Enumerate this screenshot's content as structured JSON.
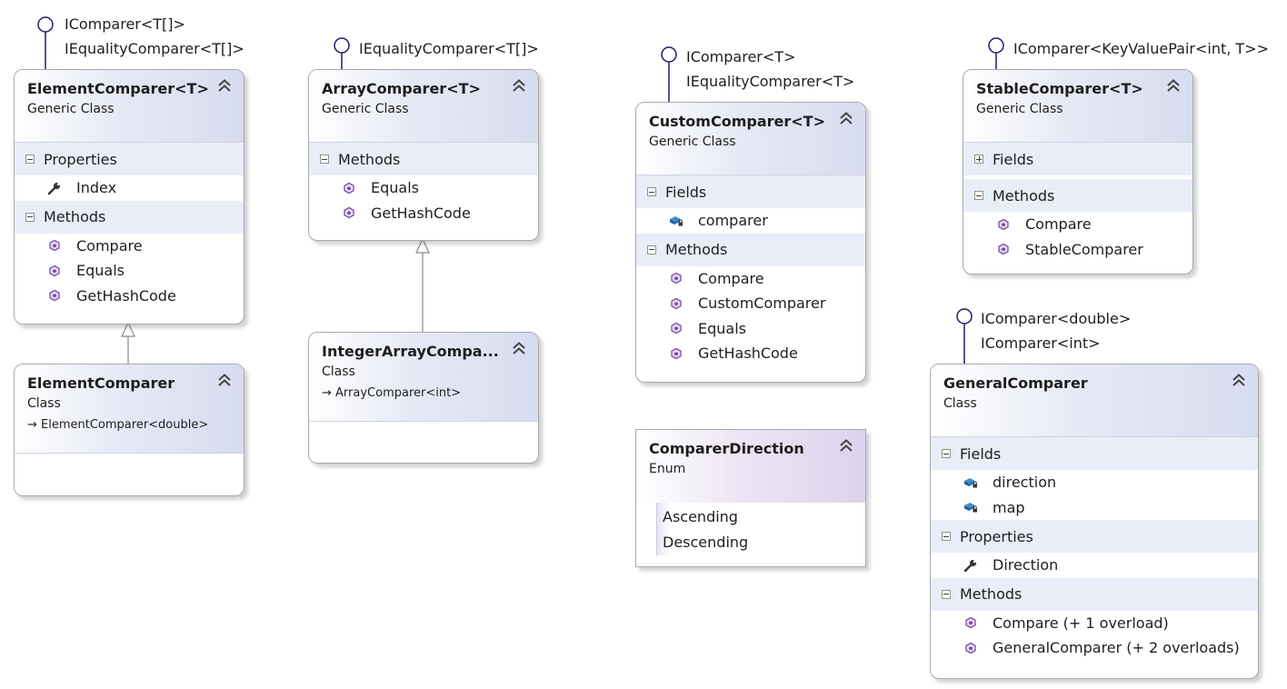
{
  "elements": {
    "element_comparer_generic": {
      "name": "ElementComparer<T>",
      "kind": "Generic Class",
      "interfaces": [
        "IComparer<T[]>",
        "IEqualityComparer<T[]>"
      ],
      "sections": [
        {
          "title": "Properties",
          "members": [
            {
              "name": "Index",
              "icon": "wrench-icon"
            }
          ]
        },
        {
          "title": "Methods",
          "members": [
            {
              "name": "Compare",
              "icon": "method-icon"
            },
            {
              "name": "Equals",
              "icon": "method-icon"
            },
            {
              "name": "GetHashCode",
              "icon": "method-icon"
            }
          ]
        }
      ]
    },
    "element_comparer": {
      "name": "ElementComparer",
      "kind": "Class",
      "base": "ElementComparer<double>"
    },
    "array_comparer": {
      "name": "ArrayComparer<T>",
      "kind": "Generic Class",
      "interfaces": [
        "IEqualityComparer<T[]>"
      ],
      "sections": [
        {
          "title": "Methods",
          "members": [
            {
              "name": "Equals",
              "icon": "method-icon"
            },
            {
              "name": "GetHashCode",
              "icon": "method-icon"
            }
          ]
        }
      ]
    },
    "integer_array_comparer": {
      "name": "IntegerArrayCompa...",
      "kind": "Class",
      "base": "ArrayComparer<int>"
    },
    "custom_comparer": {
      "name": "CustomComparer<T>",
      "kind": "Generic Class",
      "interfaces": [
        "IComparer<T>",
        "IEqualityComparer<T>"
      ],
      "sections": [
        {
          "title": "Fields",
          "members": [
            {
              "name": "comparer",
              "icon": "field-icon"
            }
          ]
        },
        {
          "title": "Methods",
          "members": [
            {
              "name": "Compare",
              "icon": "method-icon"
            },
            {
              "name": "CustomComparer",
              "icon": "method-icon"
            },
            {
              "name": "Equals",
              "icon": "method-icon"
            },
            {
              "name": "GetHashCode",
              "icon": "method-icon"
            }
          ]
        }
      ]
    },
    "comparer_direction": {
      "name": "ComparerDirection",
      "kind": "Enum",
      "values": [
        "Ascending",
        "Descending"
      ]
    },
    "stable_comparer": {
      "name": "StableComparer<T>",
      "kind": "Generic Class",
      "interfaces": [
        "IComparer<KeyValuePair<int, T>>"
      ],
      "sections": [
        {
          "title": "Fields",
          "collapsed": true,
          "members": []
        },
        {
          "title": "Methods",
          "members": [
            {
              "name": "Compare",
              "icon": "method-icon"
            },
            {
              "name": "StableComparer",
              "icon": "method-icon"
            }
          ]
        }
      ]
    },
    "general_comparer": {
      "name": "GeneralComparer",
      "kind": "Class",
      "interfaces": [
        "IComparer<double>",
        "IComparer<int>"
      ],
      "sections": [
        {
          "title": "Fields",
          "members": [
            {
              "name": "direction",
              "icon": "field-icon"
            },
            {
              "name": "map",
              "icon": "field-icon"
            }
          ]
        },
        {
          "title": "Properties",
          "members": [
            {
              "name": "Direction",
              "icon": "wrench-icon"
            }
          ]
        },
        {
          "title": "Methods",
          "members": [
            {
              "name": "Compare (+ 1 overload)",
              "icon": "method-icon"
            },
            {
              "name": "GeneralComparer (+ 2 overloads)",
              "icon": "method-icon"
            }
          ]
        }
      ]
    }
  },
  "relationships": [
    {
      "from": "element_comparer",
      "to": "element_comparer_generic",
      "type": "inheritance"
    },
    {
      "from": "integer_array_comparer",
      "to": "array_comparer",
      "type": "inheritance"
    }
  ],
  "colors": {
    "header_class": "#d7dcef",
    "header_enum": "#ddd2ec",
    "section_band": "#e9edf7",
    "lollipop": "#1f1a6e",
    "method_icon": "#7a4fa8"
  }
}
